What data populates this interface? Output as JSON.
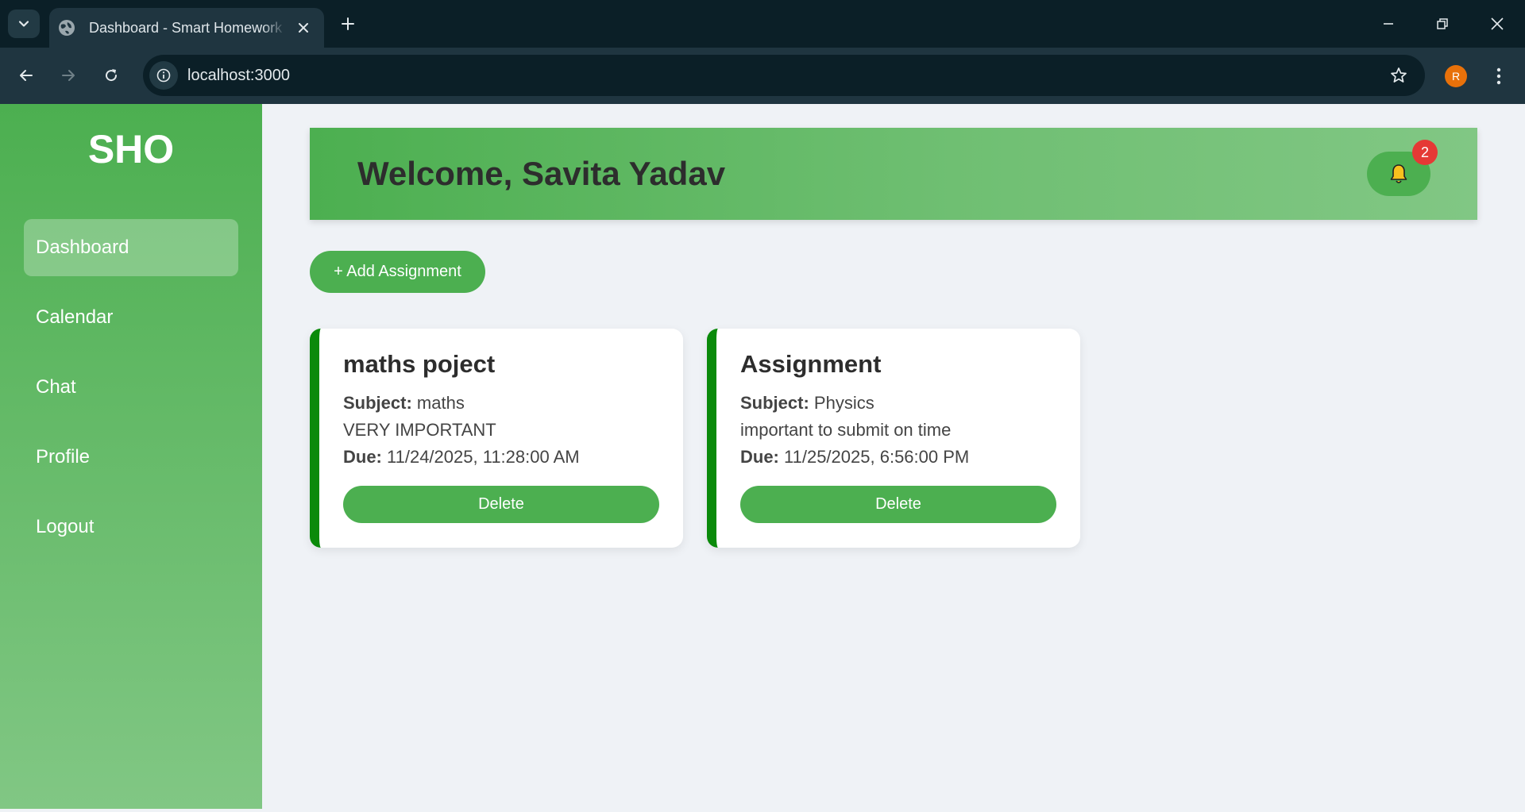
{
  "browser": {
    "tab_title": "Dashboard - Smart Homework Organizer",
    "url": "localhost:3000",
    "profile_initial": "R"
  },
  "sidebar": {
    "brand": "SHO",
    "items": [
      {
        "label": "Dashboard",
        "active": true
      },
      {
        "label": "Calendar",
        "active": false
      },
      {
        "label": "Chat",
        "active": false
      },
      {
        "label": "Profile",
        "active": false
      },
      {
        "label": "Logout",
        "active": false
      }
    ]
  },
  "header": {
    "welcome": "Welcome, Savita Yadav",
    "notification_count": "2"
  },
  "actions": {
    "add_assignment_label": "+ Add Assignment"
  },
  "assignments": [
    {
      "title": "maths poject",
      "subject_label": "Subject:",
      "subject": "maths",
      "description": "VERY IMPORTANT",
      "due_label": "Due:",
      "due": "11/24/2025, 11:28:00 AM",
      "delete_label": "Delete"
    },
    {
      "title": "Assignment",
      "subject_label": "Subject:",
      "subject": "Physics",
      "description": "important to submit on time",
      "due_label": "Due:",
      "due": "11/25/2025, 6:56:00 PM",
      "delete_label": "Delete"
    }
  ],
  "colors": {
    "primary": "#4caf50",
    "card_accent": "#0a8a0a",
    "badge": "#e53935",
    "bell": "#f9c11e",
    "page_bg": "#eff2f6"
  },
  "icons": {
    "tab_search": "chevron-down-icon",
    "favicon": "globe-icon",
    "tab_close": "close-icon",
    "new_tab": "plus-icon",
    "back": "arrow-left-icon",
    "forward": "arrow-right-icon",
    "reload": "reload-icon",
    "site_info": "info-icon",
    "bookmark": "star-icon",
    "menu": "kebab-menu-icon",
    "notifications": "bell-icon"
  }
}
